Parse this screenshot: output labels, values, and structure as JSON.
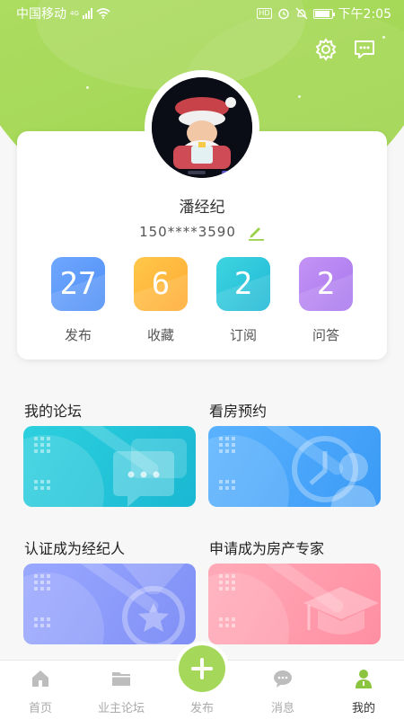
{
  "status_bar": {
    "carrier": "中国移动",
    "network": "4G",
    "hd": "HD",
    "time": "下午2:05"
  },
  "header": {
    "settings_icon": "gear-icon",
    "message_icon": "chat-bubble-icon"
  },
  "profile": {
    "name": "潘经纪",
    "phone": "150****3590",
    "edit_icon": "pencil-icon"
  },
  "stats": [
    {
      "value": "27",
      "label": "发布",
      "color_from": "#6fa7ff",
      "color_to": "#4f8ff5"
    },
    {
      "value": "6",
      "label": "收藏",
      "color_from": "#ffc84a",
      "color_to": "#ffaa33"
    },
    {
      "value": "2",
      "label": "订阅",
      "color_from": "#3ed5e0",
      "color_to": "#1fb8d6"
    },
    {
      "value": "2",
      "label": "问答",
      "color_from": "#c493f5",
      "color_to": "#a877ee"
    }
  ],
  "features": [
    {
      "title": "我的论坛",
      "icon": "chat-bubbles-icon",
      "color_from": "#2cd0de",
      "color_to": "#1ab8d3"
    },
    {
      "title": "看房预约",
      "icon": "user-clock-icon",
      "color_from": "#5ab2ff",
      "color_to": "#3a9af5"
    },
    {
      "title": "认证成为经纪人",
      "icon": "medal-star-icon",
      "color_from": "#9aa8ff",
      "color_to": "#7f8ff5"
    },
    {
      "title": "申请成为房产专家",
      "icon": "graduation-cap-icon",
      "color_from": "#ffaab8",
      "color_to": "#ff8fa2"
    }
  ],
  "tabbar": {
    "items": [
      {
        "label": "首页",
        "icon": "home-icon",
        "active": false
      },
      {
        "label": "业主论坛",
        "icon": "folder-icon",
        "active": false
      },
      {
        "label": "发布",
        "icon": "plus-icon",
        "active": false
      },
      {
        "label": "消息",
        "icon": "message-icon",
        "active": false
      },
      {
        "label": "我的",
        "icon": "person-icon",
        "active": true
      }
    ]
  },
  "colors": {
    "brand_green": "#a5d85a",
    "inactive_gray": "#aaaaaa"
  }
}
